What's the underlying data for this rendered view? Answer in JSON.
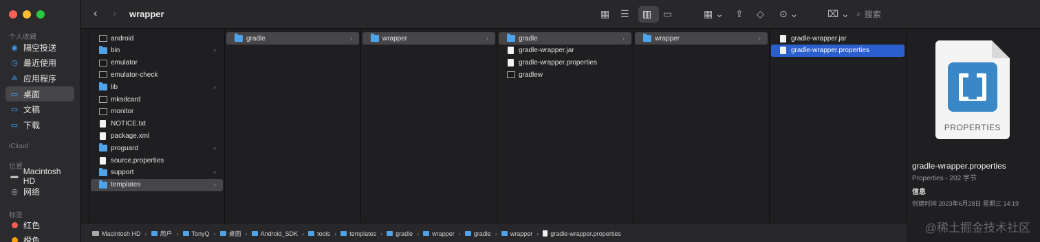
{
  "toolbar": {
    "title": "wrapper",
    "back": "‹",
    "forward": "›",
    "search_placeholder": "搜索"
  },
  "sidebar": {
    "favorites_header": "个人收藏",
    "favorites": [
      {
        "label": "隔空投送",
        "icon": "airdrop-icon"
      },
      {
        "label": "最近使用",
        "icon": "clock-icon"
      },
      {
        "label": "应用程序",
        "icon": "apps-icon"
      },
      {
        "label": "桌面",
        "icon": "desktop-icon",
        "selected": true
      },
      {
        "label": "文稿",
        "icon": "document-icon"
      },
      {
        "label": "下载",
        "icon": "download-icon"
      }
    ],
    "icloud_header": "iCloud",
    "locations_header": "位置",
    "locations": [
      {
        "label": "Macintosh HD",
        "icon": "disk-icon"
      },
      {
        "label": "网络",
        "icon": "network-icon"
      }
    ],
    "tags_header": "标签",
    "tags": [
      {
        "label": "红色",
        "color": "#ff5b52"
      },
      {
        "label": "橙色",
        "color": "#ff9f0a"
      }
    ]
  },
  "columns": [
    {
      "items": [
        {
          "label": "android",
          "type": "exec"
        },
        {
          "label": "bin",
          "type": "folder",
          "chevron": true
        },
        {
          "label": "emulator",
          "type": "exec"
        },
        {
          "label": "emulator-check",
          "type": "exec"
        },
        {
          "label": "lib",
          "type": "folder",
          "chevron": true
        },
        {
          "label": "mksdcard",
          "type": "exec"
        },
        {
          "label": "monitor",
          "type": "exec"
        },
        {
          "label": "NOTICE.txt",
          "type": "doc"
        },
        {
          "label": "package.xml",
          "type": "doc"
        },
        {
          "label": "proguard",
          "type": "folder",
          "chevron": true
        },
        {
          "label": "source.properties",
          "type": "doc"
        },
        {
          "label": "support",
          "type": "folder",
          "chevron": true
        },
        {
          "label": "templates",
          "type": "folder",
          "chevron": true,
          "selected": "gray"
        }
      ]
    },
    {
      "items": [
        {
          "label": "gradle",
          "type": "folder",
          "chevron": true,
          "selected": "gray"
        }
      ]
    },
    {
      "items": [
        {
          "label": "wrapper",
          "type": "folder",
          "chevron": true,
          "selected": "gray"
        }
      ]
    },
    {
      "items": [
        {
          "label": "gradle",
          "type": "folder",
          "chevron": true,
          "selected": "gray"
        },
        {
          "label": "gradle-wrapper.jar",
          "type": "doc"
        },
        {
          "label": "gradle-wrapper.properties",
          "type": "doc"
        },
        {
          "label": "gradlew",
          "type": "exec"
        }
      ]
    },
    {
      "items": [
        {
          "label": "wrapper",
          "type": "folder",
          "chevron": true,
          "selected": "gray"
        }
      ]
    },
    {
      "items": [
        {
          "label": "gradle-wrapper.jar",
          "type": "doc"
        },
        {
          "label": "gradle-wrapper.properties",
          "type": "doc",
          "selected": "blue"
        }
      ]
    }
  ],
  "preview": {
    "icon_label": "PROPERTIES",
    "file_name": "gradle-wrapper.properties",
    "kind": "Properties - 202 字节",
    "info_header": "信息",
    "created_row": "创建时间    2023年6月28日 星期三 14:19"
  },
  "pathbar": {
    "crumbs": [
      {
        "label": "Macintosh HD",
        "type": "disk"
      },
      {
        "label": "用户",
        "type": "folder"
      },
      {
        "label": "TonyQ",
        "type": "folder"
      },
      {
        "label": "桌面",
        "type": "folder"
      },
      {
        "label": "Android_SDK",
        "type": "folder"
      },
      {
        "label": "tools",
        "type": "folder"
      },
      {
        "label": "templates",
        "type": "folder"
      },
      {
        "label": "gradle",
        "type": "folder"
      },
      {
        "label": "wrapper",
        "type": "folder"
      },
      {
        "label": "gradle",
        "type": "folder"
      },
      {
        "label": "wrapper",
        "type": "folder"
      },
      {
        "label": "gradle-wrapper.properties",
        "type": "doc"
      }
    ]
  },
  "watermark": "@稀土掘金技术社区"
}
